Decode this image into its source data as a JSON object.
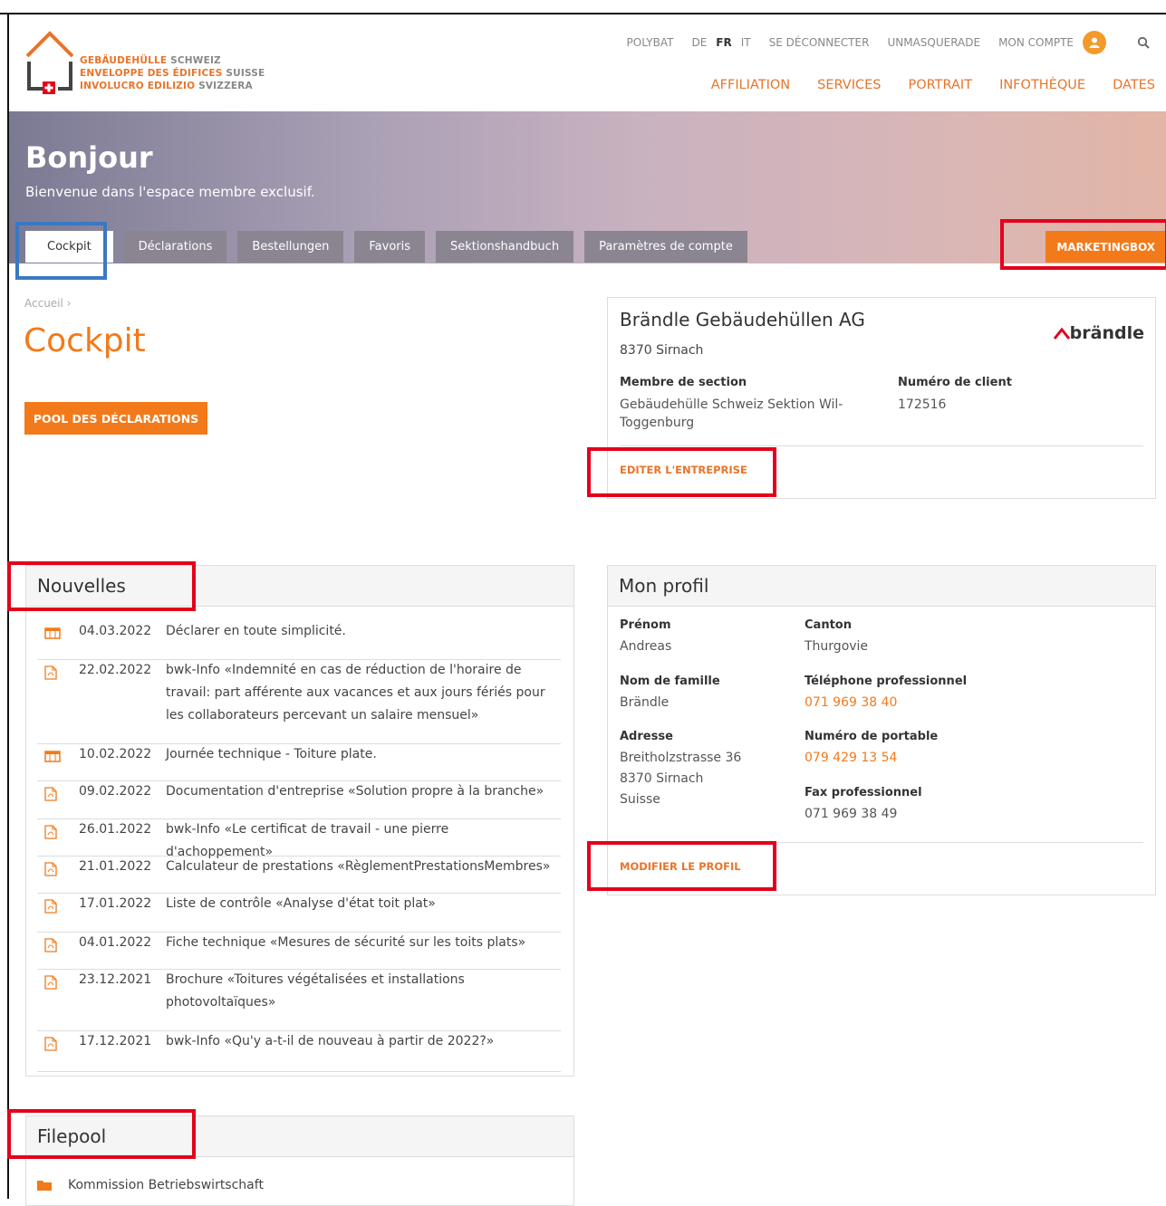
{
  "logo": {
    "line1_bold": "GEBÄUDEHÜLLE",
    "line1_light": "SCHWEIZ",
    "line2_bold": "ENVELOPPE DES ÉDIFICES",
    "line2_light": "SUISSE",
    "line3_bold": "INVOLUCRO EDILIZIO",
    "line3_light": "SVIZZERA"
  },
  "topnav": {
    "polybat": "POLYBAT",
    "langs": [
      "DE",
      "FR",
      "IT"
    ],
    "active_lang": "FR",
    "logout": "SE DÉCONNECTER",
    "unmask": "UNMASQUERADE",
    "account": "MON COMPTE"
  },
  "mainnav": [
    "AFFILIATION",
    "SERVICES",
    "PORTRAIT",
    "INFOTHÈQUE",
    "DATES"
  ],
  "hero": {
    "title": "Bonjour",
    "subtitle": "Bienvenue dans l'espace membre exclusif."
  },
  "tabs": [
    "Cockpit",
    "Déclarations",
    "Bestellungen",
    "Favoris",
    "Sektionshandbuch",
    "Paramètres de compte"
  ],
  "marketing_box": "MARKETINGBOX",
  "breadcrumb": "Accueil ›",
  "page_title": "Cockpit",
  "pool_button": "POOL DES DÉCLARATIONS",
  "company": {
    "name": "Brändle Gebäudehüllen AG",
    "city": "8370 Sirnach",
    "brand_logo": "brändle",
    "section_label": "Membre de section",
    "section_value": "Gebäudehülle Schweiz Sektion Wil-Toggenburg",
    "client_label": "Numéro de client",
    "client_value": "172516",
    "edit": "EDITER L'ENTREPRISE"
  },
  "news": {
    "title": "Nouvelles",
    "items": [
      {
        "icon": "calendar-icon",
        "date": "04.03.2022",
        "text": "Déclarer en toute simplicité."
      },
      {
        "icon": "pdf-icon",
        "date": "22.02.2022",
        "text": "bwk-Info «Indemnité en cas de réduction de l'horaire de travail: part afférente aux vacances et aux jours fériés pour les collaborateurs percevant un salaire mensuel»"
      },
      {
        "icon": "calendar-icon",
        "date": "10.02.2022",
        "text": "Journée technique - Toiture plate."
      },
      {
        "icon": "pdf-icon",
        "date": "09.02.2022",
        "text": "Documentation d'entreprise «Solution propre à la branche»"
      },
      {
        "icon": "pdf-icon",
        "date": "26.01.2022",
        "text": "bwk-Info «Le certificat de travail - une pierre d'achoppement»"
      },
      {
        "icon": "pdf-icon",
        "date": "21.01.2022",
        "text": "Calculateur de prestations «RèglementPrestationsMembres»"
      },
      {
        "icon": "pdf-icon",
        "date": "17.01.2022",
        "text": "Liste de contrôle «Analyse d'état toit plat»"
      },
      {
        "icon": "pdf-icon",
        "date": "04.01.2022",
        "text": "Fiche technique «Mesures de sécurité sur les toits plats»"
      },
      {
        "icon": "pdf-icon",
        "date": "23.12.2021",
        "text": "Brochure «Toitures végétalisées et installations photovoltaïques»"
      },
      {
        "icon": "pdf-icon",
        "date": "17.12.2021",
        "text": "bwk-Info «Qu'y a-t-il de nouveau à partir de 2022?»"
      }
    ]
  },
  "profile": {
    "title": "Mon profil",
    "first_name_label": "Prénom",
    "first_name": "Andreas",
    "canton_label": "Canton",
    "canton": "Thurgovie",
    "last_name_label": "Nom de famille",
    "last_name": "Brändle",
    "phone_label": "Téléphone professionnel",
    "phone": "071 969 38 40",
    "address_label": "Adresse",
    "address1": "Breitholzstrasse 36",
    "address2": "8370 Sirnach",
    "address3": "Suisse",
    "mobile_label": "Numéro de portable",
    "mobile": "079 429 13 54",
    "fax_label": "Fax professionnel",
    "fax": "071 969 38 49",
    "modify": "MODIFIER LE PROFIL"
  },
  "filepool": {
    "title": "Filepool",
    "item": "Kommission Betriebswirtschaft"
  },
  "colors": {
    "accent": "#f27a1a",
    "highlight_red": "#e4001b",
    "highlight_blue": "#3a78c3"
  }
}
